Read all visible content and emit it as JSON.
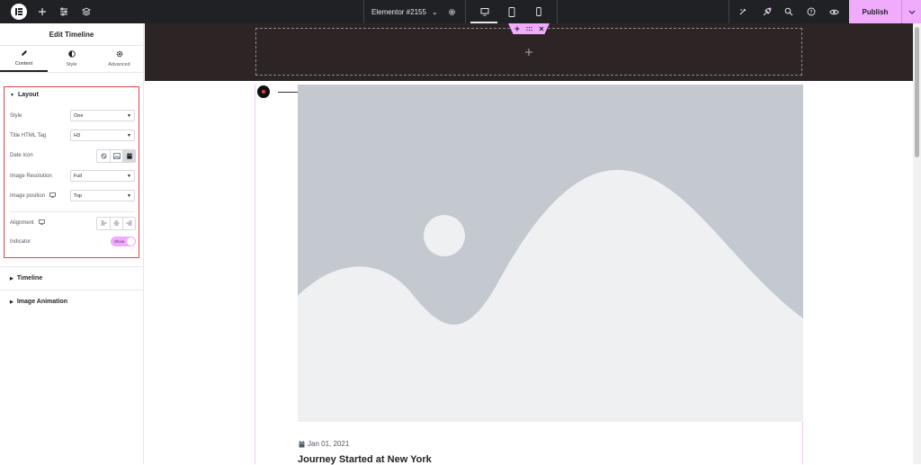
{
  "topbar": {
    "document_title": "Elementor #2155",
    "publish_label": "Publish"
  },
  "panel": {
    "title": "Edit Timeline",
    "tabs": [
      {
        "label": "Content",
        "icon": "pencil-icon"
      },
      {
        "label": "Style",
        "icon": "half-circle-icon"
      },
      {
        "label": "Advanced",
        "icon": "gear-icon"
      }
    ],
    "layout_section": {
      "title": "Layout",
      "style": {
        "label": "Style",
        "value": "One"
      },
      "title_html_tag": {
        "label": "Title HTML Tag",
        "value": "H3"
      },
      "date_icon": {
        "label": "Date Icon",
        "options": [
          "none",
          "image",
          "icon"
        ],
        "selected": "icon"
      },
      "image_resolution": {
        "label": "Image Resolution",
        "value": "Full"
      },
      "image_position": {
        "label": "Image position",
        "value": "Top"
      },
      "alignment": {
        "label": "Alignment",
        "options": [
          "left",
          "center",
          "right"
        ]
      },
      "indicator": {
        "label": "Indicator",
        "toggle_text": "Show",
        "on": true
      }
    },
    "collapsed_sections": [
      "Timeline",
      "Image Animation"
    ]
  },
  "canvas": {
    "timeline_item": {
      "date": "Jan 01, 2021",
      "title": "Journey Started at New York"
    }
  },
  "colors": {
    "accent": "#f0abfc",
    "topbar_bg": "#1f2124",
    "dark_section_bg": "#2c2425",
    "highlight_border": "#e0434e",
    "placeholder_bg": "#c4c9d0"
  }
}
